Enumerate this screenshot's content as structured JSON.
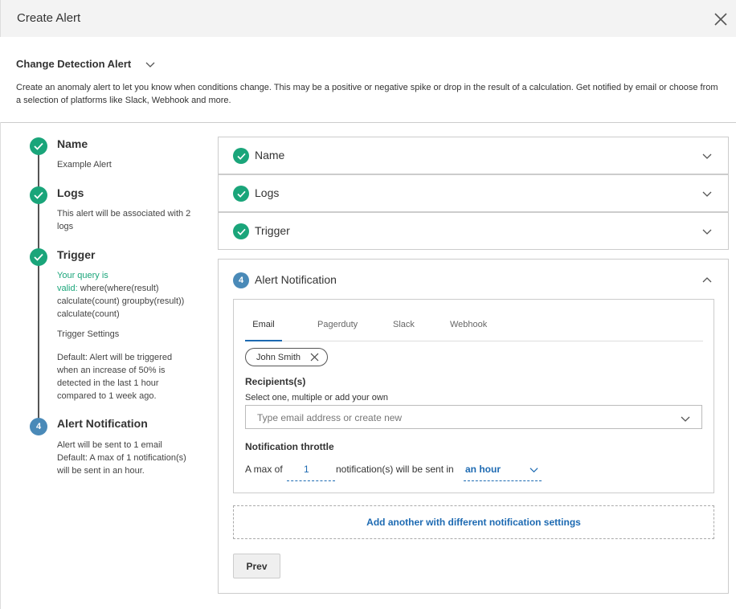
{
  "dialog": {
    "title": "Create Alert"
  },
  "alert_type": {
    "selected": "Change Detection Alert",
    "description": "Create an anomaly alert to let you know when conditions change. This may be a positive or negative spike or drop in the result of a calculation. Get notified by email or choose from a selection of platforms like Slack, Webhook and more."
  },
  "steps": [
    {
      "title": "Name",
      "text": "Example Alert"
    },
    {
      "title": "Logs",
      "text": "This alert will be associated with 2 logs"
    },
    {
      "title": "Trigger",
      "query_prefix": "Your query is",
      "query_valid": "valid:",
      "query": "where(where(result) calculate(count) groupby(result)) calculate(count)",
      "settings_label": "Trigger Settings",
      "settings_text": "Default: Alert will be triggered when an increase of 50% is detected in the last 1 hour compared to 1 week ago."
    },
    {
      "number": "4",
      "title": "Alert Notification",
      "text_1": "Alert will be sent to 1 email",
      "text_2": "Default: A max of 1 notification(s) will be sent in an hour."
    }
  ],
  "accordion": [
    {
      "label": "Name"
    },
    {
      "label": "Logs"
    },
    {
      "label": "Trigger"
    }
  ],
  "notification": {
    "number": "4",
    "title": "Alert Notification",
    "tabs": [
      "Email",
      "Pagerduty",
      "Slack",
      "Webhook"
    ],
    "active_tab": "Email",
    "chip": "John Smith",
    "recipients_label": "Recipients(s)",
    "recipients_hint": "Select one, multiple or add your own",
    "email_placeholder": "Type email address or create new",
    "throttle_label": "Notification throttle",
    "throttle_prefix": "A max of",
    "throttle_value": "1",
    "throttle_mid": "notification(s) will be sent in",
    "throttle_period": "an hour",
    "add_another": "Add another with different notification settings",
    "prev": "Prev"
  },
  "colors": {
    "success": "#1aa57a",
    "step_number": "#4a8ab8",
    "link": "#1d6ab2"
  }
}
